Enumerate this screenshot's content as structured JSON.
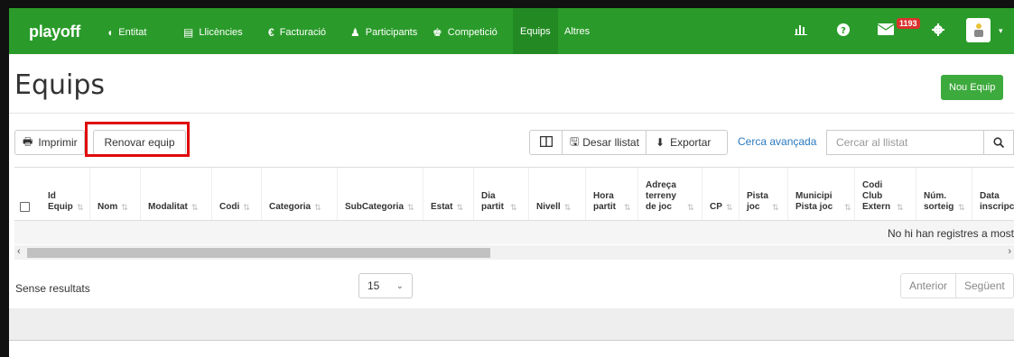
{
  "navbar": {
    "brand": "playoff",
    "items": [
      {
        "label": "Entitat",
        "icon": "shield-icon",
        "glyph": "◖"
      },
      {
        "label": "Llicències",
        "icon": "id-card-icon",
        "glyph": "▤"
      },
      {
        "label": "Facturació",
        "icon": "euro-icon",
        "glyph": "€"
      },
      {
        "label": "Participants",
        "icon": "user-icon",
        "glyph": "♟"
      },
      {
        "label": "Competició",
        "icon": "trophy-icon",
        "glyph": "♚"
      },
      {
        "label": "Equips",
        "active": true
      },
      {
        "label": "Altres"
      }
    ],
    "right": {
      "stats_icon": "bar-chart-icon",
      "help_icon": "question-icon",
      "mail_icon": "envelope-icon",
      "mail_badge": "1193",
      "settings_icon": "gear-icon",
      "avatar_icon": "user-avatar-icon"
    }
  },
  "page": {
    "title": "Equips",
    "new_button": "Nou Equip"
  },
  "toolbar": {
    "print_label": "Imprimir",
    "renew_label": "Renovar equip",
    "save_list_label": "Desar llistat",
    "export_label": "Exportar",
    "advanced_search": "Cerca avançada",
    "search_placeholder": "Cercar al llistat"
  },
  "table": {
    "columns": [
      {
        "label": "Id Equip"
      },
      {
        "label": "Nom"
      },
      {
        "label": "Modalitat"
      },
      {
        "label": "Codi"
      },
      {
        "label": "Categoria"
      },
      {
        "label": "SubCategoria"
      },
      {
        "label": "Estat"
      },
      {
        "label": "Dia partit"
      },
      {
        "label": "Nivell"
      },
      {
        "label": "Hora partit"
      },
      {
        "label": "Adreça terreny de joc"
      },
      {
        "label": "CP"
      },
      {
        "label": "Pista joc"
      },
      {
        "label": "Municipi Pista joc"
      },
      {
        "label": "Codi Club Extern"
      },
      {
        "label": "Núm. sorteig"
      },
      {
        "label": "Data inscripci"
      }
    ],
    "empty_message": "No hi han registres a most"
  },
  "footer": {
    "no_results": "Sense resultats",
    "page_size": "15",
    "prev": "Anterior",
    "next": "Següent"
  },
  "colors": {
    "navbar": "#2a9b2a",
    "primary_button": "#3daa3d",
    "highlight": "#e00b0b",
    "link": "#2a7ac0"
  }
}
